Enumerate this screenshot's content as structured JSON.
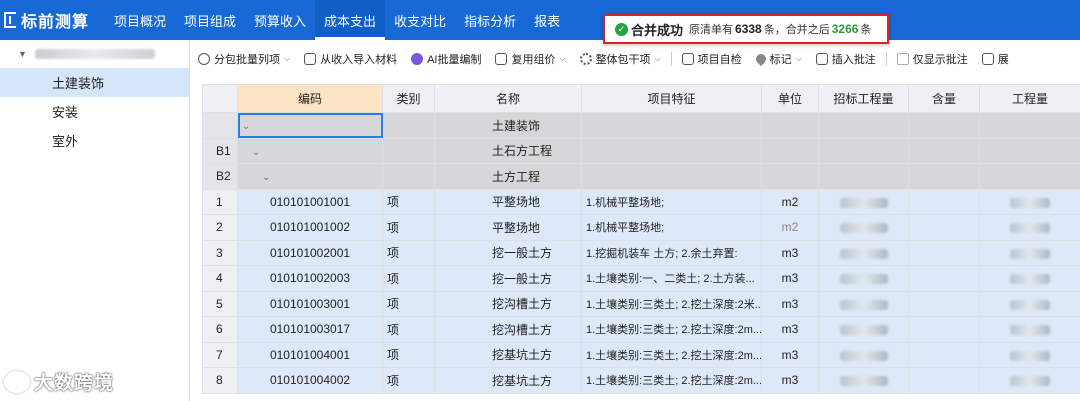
{
  "app": {
    "title": "标前测算"
  },
  "nav": {
    "tabs": [
      {
        "label": "项目概况"
      },
      {
        "label": "项目组成"
      },
      {
        "label": "预算收入"
      },
      {
        "label": "成本支出",
        "active": true
      },
      {
        "label": "收支对比"
      },
      {
        "label": "指标分析"
      },
      {
        "label": "报表"
      }
    ]
  },
  "toast": {
    "title": "合并成功",
    "before_label": "原清单有",
    "before_count": "6338",
    "unit1": "条，合并之后",
    "after_count": "3266",
    "unit2": "条",
    "after_color": "#2a9a3c",
    "border_color": "#d62525"
  },
  "sidebar": {
    "items": [
      {
        "label": "土建装饰",
        "selected": true
      },
      {
        "label": "安装"
      },
      {
        "label": "室外"
      }
    ]
  },
  "toolbar": {
    "items": [
      {
        "label": "分包批量列项",
        "icon": "split-icon",
        "dropdown": true
      },
      {
        "label": "从收入导入材料",
        "icon": "import-icon",
        "dropdown": false
      },
      {
        "label": "AI批量编制",
        "icon": "ai-icon",
        "dropdown": false
      },
      {
        "label": "复用组价",
        "icon": "reuse-icon",
        "dropdown": true
      },
      {
        "label": "整体包干项",
        "icon": "gear-icon",
        "dropdown": true
      },
      {
        "label": "项目自检",
        "icon": "check-icon",
        "dropdown": false
      },
      {
        "label": "标记",
        "icon": "mark-icon",
        "dropdown": true
      },
      {
        "label": "插入批注",
        "icon": "comment-icon",
        "dropdown": false
      },
      {
        "label": "仅显示批注",
        "icon": "checkbox-icon",
        "dropdown": false
      },
      {
        "label": "展",
        "icon": "expand-icon",
        "dropdown": false
      }
    ]
  },
  "grid": {
    "columns": [
      "",
      "编码",
      "类别",
      "名称",
      "项目特征",
      "单位",
      "招标工程量",
      "含量",
      "工程量"
    ],
    "rows": [
      {
        "rn": "",
        "code": "",
        "type": "",
        "name": "土建装饰",
        "feature": "",
        "unit": "",
        "kind": "grp",
        "level": 0
      },
      {
        "rn": "B1",
        "code": "",
        "type": "",
        "name": "土石方工程",
        "feature": "",
        "unit": "",
        "kind": "grp",
        "level": 1
      },
      {
        "rn": "B2",
        "code": "",
        "type": "",
        "name": "土方工程",
        "feature": "",
        "unit": "",
        "kind": "grp",
        "level": 2
      },
      {
        "rn": "1",
        "code": "010101001001",
        "type": "项",
        "name": "平整场地",
        "feature": "1.机械平整场地;",
        "unit": "m2",
        "kind": "item"
      },
      {
        "rn": "2",
        "code": "010101001002",
        "type": "项",
        "name": "平整场地",
        "feature": "1.机械平整场地;",
        "unit": "m2",
        "kind": "item"
      },
      {
        "rn": "3",
        "code": "010101002001",
        "type": "项",
        "name": "挖一般土方",
        "feature": "1.挖掘机装车 土方; 2.余土弃置:",
        "unit": "m3",
        "kind": "item"
      },
      {
        "rn": "4",
        "code": "010101002003",
        "type": "项",
        "name": "挖一般土方",
        "feature": "1.土壤类别:一、二类土; 2.土方装...",
        "unit": "m3",
        "kind": "item"
      },
      {
        "rn": "5",
        "code": "010101003001",
        "type": "项",
        "name": "挖沟槽土方",
        "feature": "1.土壤类别:三类土; 2.挖土深度:2米...",
        "unit": "m3",
        "kind": "item"
      },
      {
        "rn": "6",
        "code": "010101003017",
        "type": "项",
        "name": "挖沟槽土方",
        "feature": "1.土壤类别:三类土; 2.挖土深度:2m...",
        "unit": "m3",
        "kind": "item"
      },
      {
        "rn": "7",
        "code": "010101004001",
        "type": "项",
        "name": "挖基坑土方",
        "feature": "1.土壤类别:三类土; 2.挖土深度:2m...",
        "unit": "m3",
        "kind": "item"
      },
      {
        "rn": "8",
        "code": "010101004002",
        "type": "项",
        "name": "挖基坑土方",
        "feature": "1.土壤类别:三类土; 2.挖土深度:2m...",
        "unit": "m3",
        "kind": "item"
      }
    ]
  },
  "watermark": {
    "text": "大数跨境"
  }
}
